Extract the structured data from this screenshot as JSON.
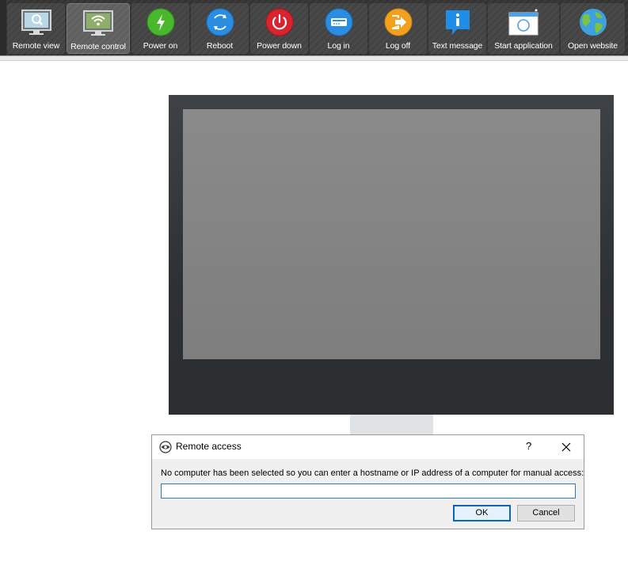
{
  "toolbar": {
    "buttons": [
      {
        "id": "remote-view",
        "label": "Remote view",
        "icon": "monitor-magnifier-icon"
      },
      {
        "id": "remote-control",
        "label": "Remote control",
        "icon": "monitor-wifi-icon",
        "active": true
      },
      {
        "id": "power-on",
        "label": "Power on",
        "icon": "power-on-icon",
        "color": "#49b82c"
      },
      {
        "id": "reboot",
        "label": "Reboot",
        "icon": "reboot-icon",
        "color": "#2b8de2"
      },
      {
        "id": "power-down",
        "label": "Power down",
        "icon": "power-down-icon",
        "color": "#d9232f"
      },
      {
        "id": "log-in",
        "label": "Log in",
        "icon": "log-in-icon",
        "color": "#2b8de2"
      },
      {
        "id": "log-off",
        "label": "Log off",
        "icon": "log-off-icon",
        "color": "#f2a11f"
      },
      {
        "id": "text-message",
        "label": "Text message",
        "icon": "text-message-icon",
        "color": "#1e8ee8"
      },
      {
        "id": "start-application",
        "label": "Start application",
        "icon": "start-application-icon"
      },
      {
        "id": "open-website",
        "label": "Open website",
        "icon": "globe-icon"
      }
    ]
  },
  "dialog": {
    "title": "Remote access",
    "help": "?",
    "message": "No computer has been selected so you can enter a hostname or IP address of a computer for manual access:",
    "input_value": "",
    "ok_label": "OK",
    "cancel_label": "Cancel"
  },
  "colors": {
    "toolbar_bg": "#383838",
    "focus_blue": "#0a64c8",
    "monitor_bezel": "#2e3134",
    "monitor_screen": "#838383"
  }
}
